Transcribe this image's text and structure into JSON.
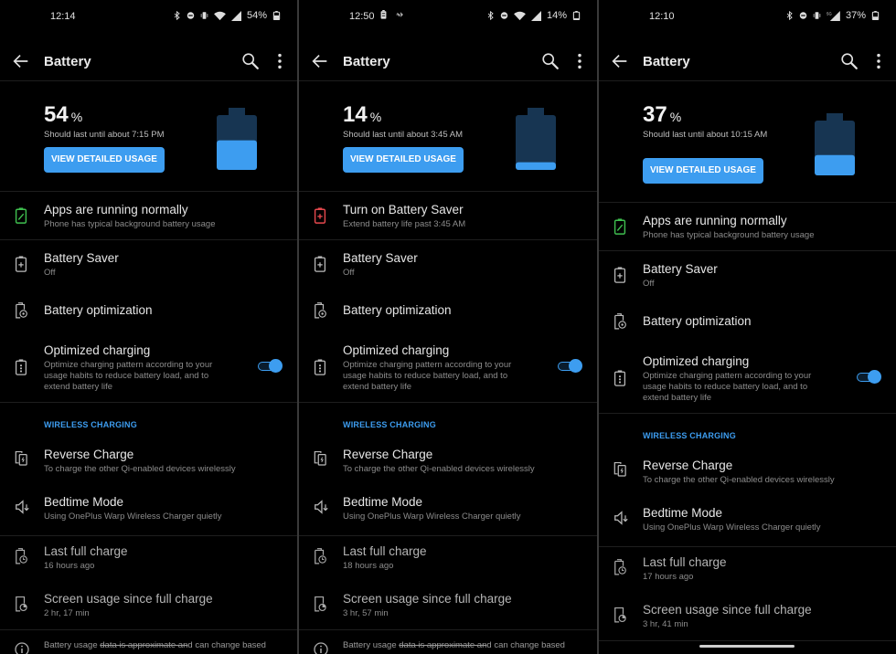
{
  "colors": {
    "accent": "#3d9df0",
    "battery_empty": "#173552",
    "green": "#3fbf4f",
    "red": "#e5484d",
    "background": "#000000"
  },
  "screens": [
    {
      "status": {
        "time": "12:14",
        "left_icons": [],
        "right_icons": [
          "bluetooth-icon",
          "dnd-icon",
          "vibrate-icon",
          "wifi-icon",
          "cell-signal-icon"
        ],
        "battery": "54%"
      },
      "appbar": {
        "title": "Battery",
        "back_icon": "back-arrow-icon",
        "search_icon": "search-icon",
        "more_icon": "more-vert-icon"
      },
      "hero": {
        "percent": "54",
        "percent_unit": "%",
        "level": 0.54,
        "estimate": "Should last until about 7:15 PM",
        "button": "VIEW DETAILED USAGE"
      },
      "tip": {
        "title": "Apps are running normally",
        "subtitle": "Phone has typical background battery usage",
        "icon": "battery-ok-icon",
        "state": "ok"
      },
      "battery_saver": {
        "title": "Battery Saver",
        "subtitle": "Off"
      },
      "battery_optimization": {
        "title": "Battery optimization"
      },
      "optimized_charging": {
        "title": "Optimized charging",
        "subtitle": "Optimize charging pattern according to your usage habits to reduce battery load, and to extend battery life",
        "enabled": true
      },
      "section_wireless": "WIRELESS CHARGING",
      "reverse_charge": {
        "title": "Reverse Charge",
        "subtitle": "To charge the other Qi-enabled devices wirelessly"
      },
      "bedtime_mode": {
        "title": "Bedtime Mode",
        "subtitle": "Using OnePlus Warp Wireless Charger quietly"
      },
      "last_full_charge": {
        "title": "Last full charge",
        "subtitle": "16 hours ago"
      },
      "screen_usage": {
        "title": "Screen usage since full charge",
        "subtitle": "2 hr, 17 min"
      },
      "footer": {
        "prefix": "Battery usage ",
        "struck": "data is approximate an",
        "suffix": "d can change based"
      }
    },
    {
      "status": {
        "time": "12:50",
        "left_icons": [
          "battery-status-icon",
          "usb-icon"
        ],
        "right_icons": [
          "bluetooth-icon",
          "dnd-icon",
          "wifi-icon",
          "cell-signal-icon"
        ],
        "battery": "14%"
      },
      "appbar": {
        "title": "Battery",
        "back_icon": "back-arrow-icon",
        "search_icon": "search-icon",
        "more_icon": "more-vert-icon"
      },
      "hero": {
        "percent": "14",
        "percent_unit": "%",
        "level": 0.14,
        "estimate": "Should last until about 3:45 AM",
        "button": "VIEW DETAILED USAGE"
      },
      "tip": {
        "title": "Turn on Battery Saver",
        "subtitle": "Extend battery life past 3:45 AM",
        "icon": "battery-saver-alert-icon",
        "state": "warn"
      },
      "battery_saver": {
        "title": "Battery Saver",
        "subtitle": "Off"
      },
      "battery_optimization": {
        "title": "Battery optimization"
      },
      "optimized_charging": {
        "title": "Optimized charging",
        "subtitle": "Optimize charging pattern according to your usage habits to reduce battery load, and to extend battery life",
        "enabled": true
      },
      "section_wireless": "WIRELESS CHARGING",
      "reverse_charge": {
        "title": "Reverse Charge",
        "subtitle": "To charge the other Qi-enabled devices wirelessly"
      },
      "bedtime_mode": {
        "title": "Bedtime Mode",
        "subtitle": "Using OnePlus Warp Wireless Charger quietly"
      },
      "last_full_charge": {
        "title": "Last full charge",
        "subtitle": "18 hours ago"
      },
      "screen_usage": {
        "title": "Screen usage since full charge",
        "subtitle": "3 hr, 57 min"
      },
      "footer": {
        "prefix": "Battery usage ",
        "struck": "data is approximate an",
        "suffix": "d can change based"
      }
    },
    {
      "status": {
        "time": "12:10",
        "left_icons": [],
        "right_icons": [
          "bluetooth-icon",
          "dnd-icon",
          "vibrate-icon",
          "cell-signal-5g-icon"
        ],
        "battery": "37%"
      },
      "appbar": {
        "title": "Battery",
        "back_icon": "back-arrow-icon",
        "search_icon": "search-icon",
        "more_icon": "more-vert-icon"
      },
      "hero": {
        "percent": "37",
        "percent_unit": "%",
        "level": 0.37,
        "estimate": "Should last until about 10:15 AM",
        "button": "VIEW DETAILED USAGE"
      },
      "tip": {
        "title": "Apps are running normally",
        "subtitle": "Phone has typical background battery usage",
        "icon": "battery-ok-icon",
        "state": "ok"
      },
      "battery_saver": {
        "title": "Battery Saver",
        "subtitle": "Off"
      },
      "battery_optimization": {
        "title": "Battery optimization"
      },
      "optimized_charging": {
        "title": "Optimized charging",
        "subtitle": "Optimize charging pattern according to your usage habits to reduce battery load, and to extend battery life",
        "enabled": true
      },
      "section_wireless": "WIRELESS CHARGING",
      "reverse_charge": {
        "title": "Reverse Charge",
        "subtitle": "To charge the other Qi-enabled devices wirelessly"
      },
      "bedtime_mode": {
        "title": "Bedtime Mode",
        "subtitle": "Using OnePlus Warp Wireless Charger quietly"
      },
      "last_full_charge": {
        "title": "Last full charge",
        "subtitle": "17 hours ago"
      },
      "screen_usage": {
        "title": "Screen usage since full charge",
        "subtitle": "3 hr, 41 min"
      },
      "footer": null
    }
  ]
}
